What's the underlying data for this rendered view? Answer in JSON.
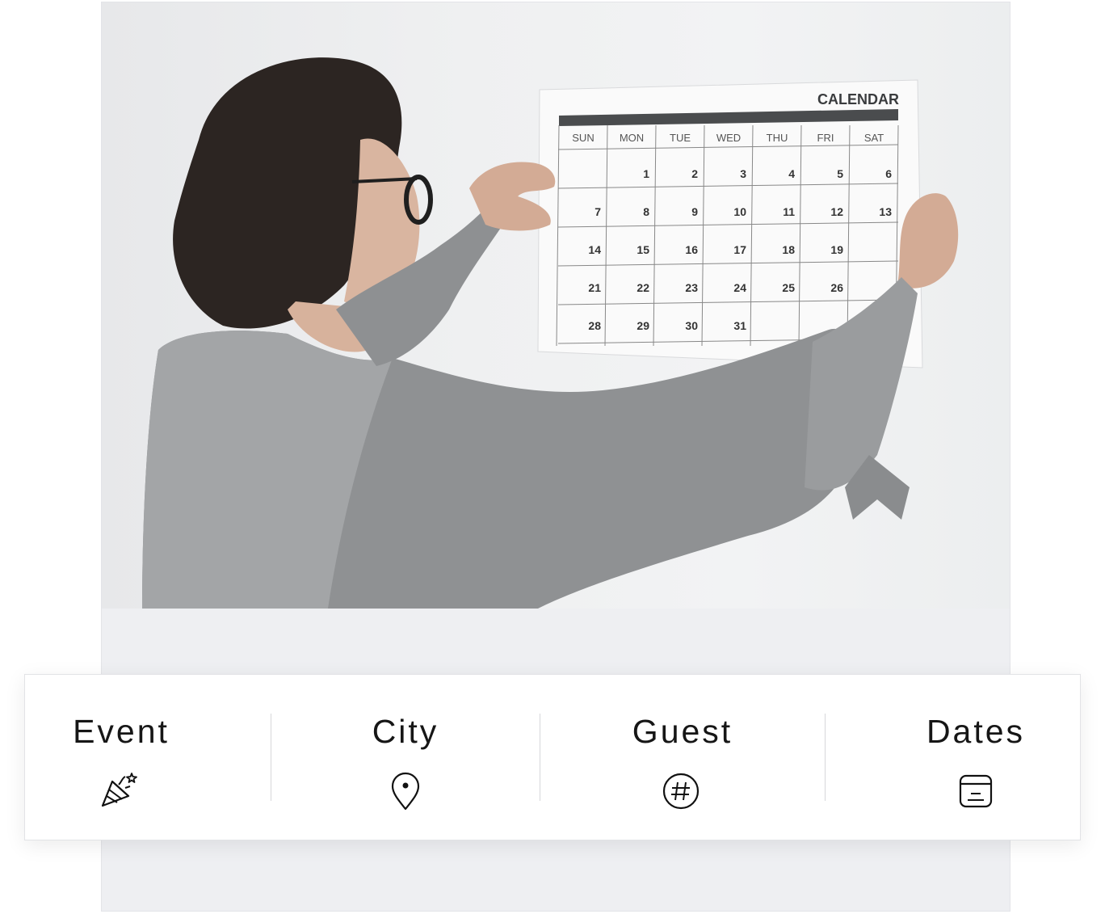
{
  "hero": {
    "image_description_icon": "woman-pinning-calendar-photo",
    "calendar": {
      "title": "CALENDAR",
      "weekdays": [
        "SUN",
        "MON",
        "TUE",
        "WED",
        "THU",
        "FRI",
        "SAT"
      ],
      "weeks": [
        [
          "",
          "1",
          "2",
          "3",
          "4",
          "5",
          "6"
        ],
        [
          "7",
          "8",
          "9",
          "10",
          "11",
          "12",
          "13"
        ],
        [
          "14",
          "15",
          "16",
          "17",
          "18",
          "19",
          ""
        ],
        [
          "21",
          "22",
          "23",
          "24",
          "25",
          "26",
          ""
        ],
        [
          "28",
          "29",
          "30",
          "31",
          "",
          "",
          ""
        ]
      ]
    }
  },
  "search_bar": {
    "fields": [
      {
        "label": "Event",
        "icon": "party-popper-icon"
      },
      {
        "label": "City",
        "icon": "map-pin-icon"
      },
      {
        "label": "Guest",
        "icon": "hash-circle-icon"
      },
      {
        "label": "Dates",
        "icon": "calendar-icon"
      }
    ]
  },
  "colors": {
    "background": "#eeeff2",
    "bar_background": "#ffffff",
    "text": "#161616",
    "divider": "#d6d7da"
  }
}
